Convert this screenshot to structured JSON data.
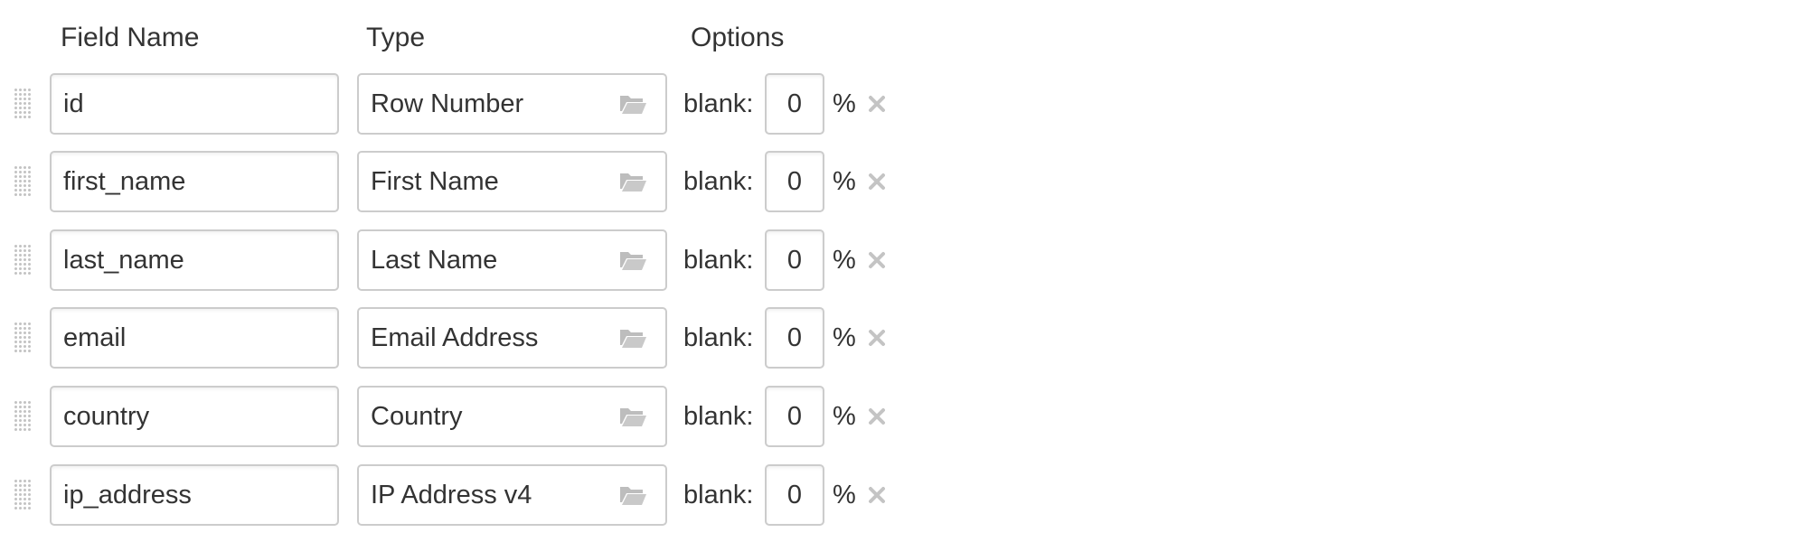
{
  "headers": {
    "field_name": "Field Name",
    "type": "Type",
    "options": "Options"
  },
  "fields": [
    {
      "name": "id",
      "type": "Row Number",
      "blank_label": "blank:",
      "blank_value": "0",
      "percent": "%"
    },
    {
      "name": "first_name",
      "type": "First Name",
      "blank_label": "blank:",
      "blank_value": "0",
      "percent": "%"
    },
    {
      "name": "last_name",
      "type": "Last Name",
      "blank_label": "blank:",
      "blank_value": "0",
      "percent": "%"
    },
    {
      "name": "email",
      "type": "Email Address",
      "blank_label": "blank:",
      "blank_value": "0",
      "percent": "%"
    },
    {
      "name": "country",
      "type": "Country",
      "blank_label": "blank:",
      "blank_value": "0",
      "percent": "%"
    },
    {
      "name": "ip_address",
      "type": "IP Address v4",
      "blank_label": "blank:",
      "blank_value": "0",
      "percent": "%"
    }
  ],
  "icons": {
    "drag": "drag-handle-icon",
    "type_picker": "folder-open-icon",
    "remove": "close-icon"
  },
  "colors": {
    "border": "#cccccc",
    "text": "#333333",
    "icon": "#c4c4c4"
  }
}
